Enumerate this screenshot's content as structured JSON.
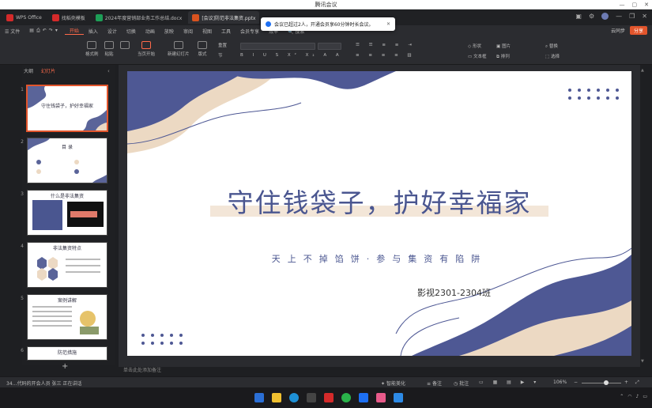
{
  "meeting": {
    "title": "腾讯会议",
    "controls": [
      "—",
      "▢",
      "✕"
    ]
  },
  "tabs": [
    {
      "label": "WPS Office",
      "color": "#d42a2a",
      "active": false
    },
    {
      "label": "找稻壳模板",
      "color": "#d42a2a",
      "active": false
    },
    {
      "label": "2024年度营销部业务工作总结.docx",
      "color": "#1d9e57",
      "active": false
    },
    {
      "label": "[会议]防范非法集资.pptx",
      "color": "#d9531f",
      "active": true
    }
  ],
  "notification": {
    "text": "会议已超过2人，开通会员享60分钟时长会议。",
    "close": "✕"
  },
  "menu": {
    "items": [
      "☰ 文件",
      "开始",
      "插入",
      "设计",
      "切换",
      "动画",
      "放映",
      "审阅",
      "视图",
      "工具",
      "会员专享",
      "效率"
    ],
    "active_index": 1,
    "search": "搜索",
    "right": [
      "云同步",
      "分享",
      "协作"
    ],
    "share": "分享"
  },
  "ribbon": {
    "groups": [
      "格式刷",
      "粘贴",
      "剪切",
      "当页开始",
      "新建幻灯片",
      "版式",
      "节",
      "重置"
    ],
    "right": [
      "形状",
      "图片",
      "替换",
      "文本框",
      "排列",
      "选择"
    ]
  },
  "sidebar": {
    "tabs": [
      "大纲",
      "幻灯片"
    ],
    "active": 1,
    "slides": [
      {
        "num": "1",
        "title": "守住钱袋子，护好幸福家"
      },
      {
        "num": "2",
        "title": "目 录"
      },
      {
        "num": "3",
        "title": "什么是非法集资"
      },
      {
        "num": "4",
        "title": "非法集资特点"
      },
      {
        "num": "5",
        "title": "案例讲解"
      },
      {
        "num": "6",
        "title": "防范措施"
      }
    ]
  },
  "slide": {
    "title": "守住钱袋子，护好幸福家",
    "subtitle": "天上不掉馅饼·参与集资有陷阱",
    "class_label": "影视2301-2304班"
  },
  "notes_placeholder": "单击此处添加备注",
  "status": {
    "slide_info": "幻灯片 1 / 14",
    "theme": "智能美化",
    "notes": "备注",
    "comments": "批注",
    "zoom": "106%",
    "zoom_fraction": 0.62
  },
  "meeting_bar": {
    "speaker": "34…代码的开会人员 张三 正在讲话"
  },
  "colors": {
    "accent": "#e2552c",
    "navy": "#4a5690",
    "beige": "#ecd9c3"
  }
}
